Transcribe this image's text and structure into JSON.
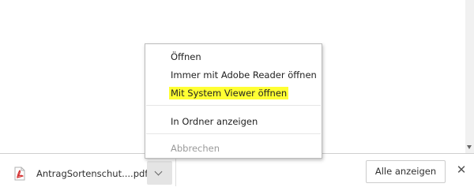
{
  "download_shelf": {
    "file_name": "AntragSortenschut....pdf",
    "file_icon": "pdf-icon",
    "show_all_label": "Alle anzeigen",
    "close_label": "✕"
  },
  "context_menu": {
    "items": [
      {
        "label": "Öffnen",
        "enabled": true
      },
      {
        "label": "Immer mit Adobe Reader öffnen",
        "enabled": true
      },
      {
        "label": "Mit System Viewer öffnen",
        "enabled": true,
        "highlighted": true
      },
      {
        "label": "In Ordner anzeigen",
        "enabled": true
      },
      {
        "label": "Abbrechen",
        "enabled": false
      }
    ]
  },
  "colors": {
    "highlight": "#ffff33",
    "pdf_red": "#d32f2f"
  }
}
